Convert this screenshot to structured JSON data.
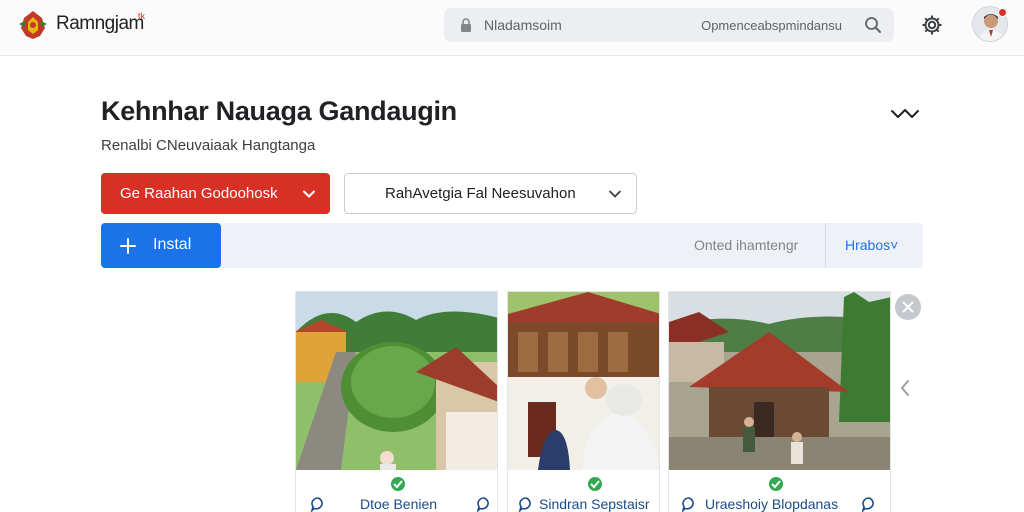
{
  "header": {
    "brand": "Ramngjam",
    "brand_mark": "tk",
    "search_placeholder": "Nladamsoim",
    "search_hint": "Opmenceabspmindansu"
  },
  "page": {
    "title": "Kehnhar Nauaga Gandaugin",
    "subtitle": "Renalbi CNeuvaiaak Hangtanga",
    "primary_dropdown": "Ge Raahan Godoohosk",
    "secondary_select": "RahAvetgia Fal Neesuvahon",
    "install_label": "Instal",
    "filter_text": "Onted ihamtengr",
    "more_label": "Hrabos"
  },
  "gallery": {
    "cards": [
      {
        "caption": "Dtoe Benien"
      },
      {
        "caption": "Sindran Sepstaisr"
      },
      {
        "caption": "Uraeshoiy Blopdanas"
      }
    ]
  },
  "colors": {
    "accent_red": "#d93025",
    "accent_blue": "#1a73e8",
    "success_green": "#34a853"
  },
  "icons": [
    "logo-emblem",
    "lock-icon",
    "search-icon",
    "gear-icon",
    "avatar",
    "collapse-icon",
    "chevron-down-icon",
    "add-icon",
    "close-icon",
    "chevron-left-icon",
    "check-icon",
    "comment-icon"
  ]
}
